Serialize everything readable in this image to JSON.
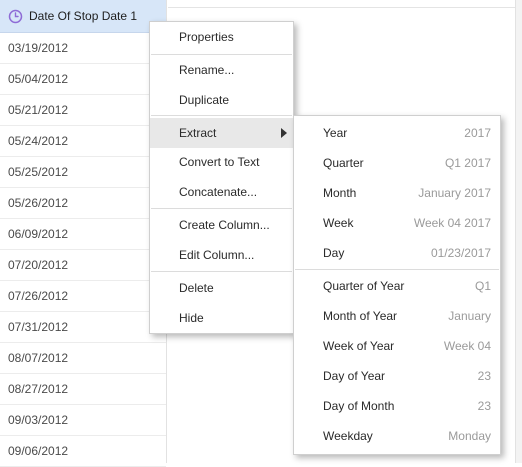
{
  "column": {
    "header": "Date Of Stop Date 1",
    "header_icon": "clock-icon",
    "rows": [
      "03/19/2012",
      "05/04/2012",
      "05/21/2012",
      "05/24/2012",
      "05/25/2012",
      "05/26/2012",
      "06/09/2012",
      "07/20/2012",
      "07/26/2012",
      "07/31/2012",
      "08/07/2012",
      "08/27/2012",
      "09/03/2012",
      "09/06/2012"
    ]
  },
  "context_menu": {
    "properties": "Properties",
    "rename": "Rename...",
    "duplicate": "Duplicate",
    "extract": "Extract",
    "convert_to_text": "Convert to Text",
    "concatenate": "Concatenate...",
    "create_column": "Create Column...",
    "edit_column": "Edit Column...",
    "delete": "Delete",
    "hide": "Hide"
  },
  "extract_submenu": {
    "items": [
      {
        "label": "Year",
        "value": "2017"
      },
      {
        "label": "Quarter",
        "value": "Q1 2017"
      },
      {
        "label": "Month",
        "value": "January 2017"
      },
      {
        "label": "Week",
        "value": "Week 04 2017"
      },
      {
        "label": "Day",
        "value": "01/23/2017"
      },
      {
        "label": "Quarter of Year",
        "value": "Q1"
      },
      {
        "label": "Month of Year",
        "value": "January"
      },
      {
        "label": "Week of Year",
        "value": "Week 04"
      },
      {
        "label": "Day of Year",
        "value": "23"
      },
      {
        "label": "Day of Month",
        "value": "23"
      },
      {
        "label": "Weekday",
        "value": "Monday"
      }
    ]
  },
  "colors": {
    "header_bg": "#d7e6f8",
    "clock_icon": "#8e6bd6",
    "menu_highlight": "#e8e8e8"
  }
}
